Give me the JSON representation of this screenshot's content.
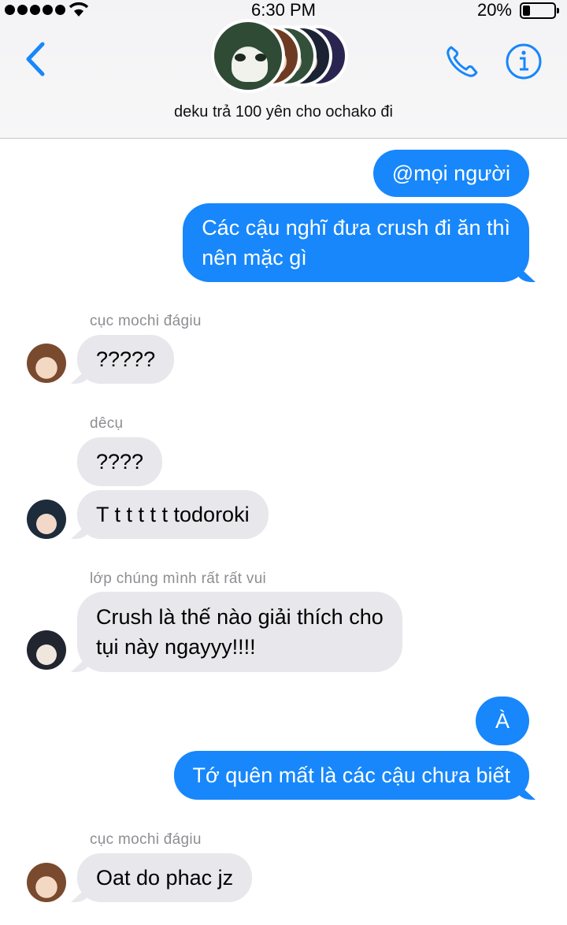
{
  "status_bar": {
    "time": "6:30 PM",
    "battery_percent": "20%",
    "battery_level": 0.2,
    "signal_dots": 5
  },
  "header": {
    "title": "deku trả 100 yên cho ochako đi",
    "accent_color": "#1787fb"
  },
  "messages": {
    "m1": "@mọi người",
    "m2_line1": "Các cậu nghĩ đưa crush đi ăn thì",
    "m2_line2": "nên mặc gì",
    "s1": "cục mochi đágiu",
    "m3": "?????",
    "s2": "dêcụ",
    "m4": "????",
    "m5": "T t t t t t todoroki",
    "s3": "lớp chúng mình rất rất vui",
    "m6_line1": "Crush là thế nào giải thích cho",
    "m6_line2": "tụi này ngayyy!!!!",
    "m7": "À",
    "m8": "Tớ quên mất là các cậu chưa biết",
    "s4": "cục mochi đágiu",
    "m9": "Oat do phac jz"
  },
  "colors": {
    "outgoing_bubble": "#1787fb",
    "incoming_bubble": "#e7e7ec",
    "sender_name": "#8e8e93"
  }
}
